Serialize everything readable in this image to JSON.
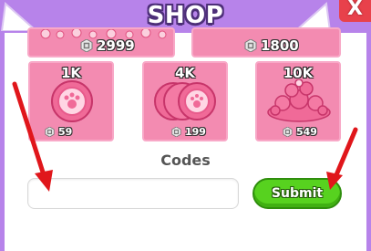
{
  "header": {
    "title": "SHOP",
    "close_label": "X"
  },
  "shop": {
    "top_row": [
      {
        "price": "2999"
      },
      {
        "price": "1800"
      }
    ],
    "items": [
      {
        "name": "1K",
        "price": "59"
      },
      {
        "name": "4K",
        "price": "199"
      },
      {
        "name": "10K",
        "price": "549"
      }
    ]
  },
  "codes": {
    "label": "Codes",
    "input_value": "",
    "submit_label": "Submit"
  },
  "colors": {
    "panel_border": "#b783ea",
    "card": "#f38bb1",
    "submit": "#57d21f",
    "close": "#e8414b",
    "arrow": "#e0161b"
  },
  "icons": [
    "robux-icon",
    "close-icon",
    "coin-icon",
    "coin-stack-icon",
    "coin-pile-icon",
    "arrow-down-icon"
  ]
}
